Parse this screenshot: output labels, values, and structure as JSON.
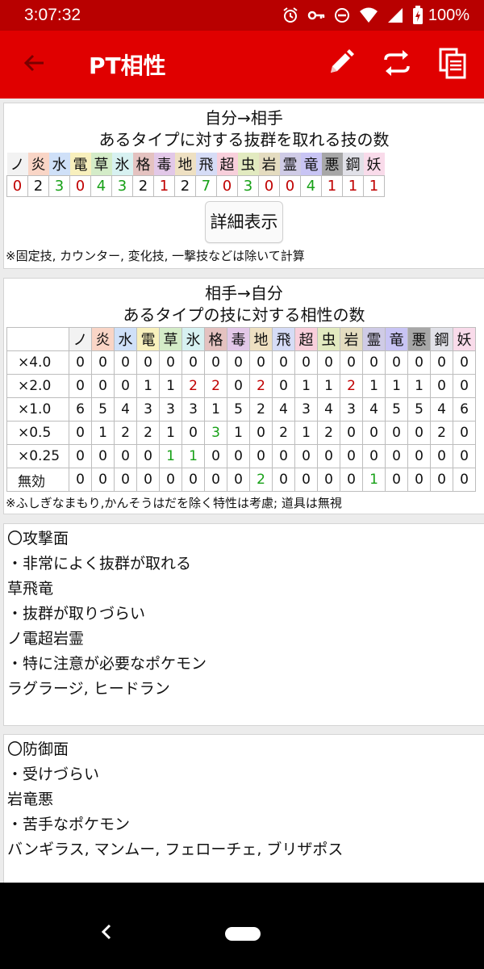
{
  "status": {
    "time": "3:07:32",
    "battery": "100%"
  },
  "appbar": {
    "title": "PT相性"
  },
  "types": [
    {
      "name": "ノ",
      "color": "#f2f2f2"
    },
    {
      "name": "炎",
      "color": "#f9d5c6"
    },
    {
      "name": "水",
      "color": "#cfe0f8"
    },
    {
      "name": "電",
      "color": "#f8f0bd"
    },
    {
      "name": "草",
      "color": "#d4ecc8"
    },
    {
      "name": "氷",
      "color": "#d7f1f1"
    },
    {
      "name": "格",
      "color": "#e4c2c0"
    },
    {
      "name": "毒",
      "color": "#e2c8e8"
    },
    {
      "name": "地",
      "color": "#eee0c2"
    },
    {
      "name": "飛",
      "color": "#d6dcf6"
    },
    {
      "name": "超",
      "color": "#f8cfdb"
    },
    {
      "name": "虫",
      "color": "#e2eac0"
    },
    {
      "name": "岩",
      "color": "#e4dcc0"
    },
    {
      "name": "霊",
      "color": "#cfcbe6"
    },
    {
      "name": "竜",
      "color": "#c8c4f4"
    },
    {
      "name": "悪",
      "color": "#a7a7a7"
    },
    {
      "name": "鋼",
      "color": "#e1e1e8"
    },
    {
      "name": "妖",
      "color": "#f9dbea"
    }
  ],
  "offense": {
    "title1": "自分→相手",
    "title2": "あるタイプに対する抜群を取れる技の数",
    "counts": [
      0,
      2,
      3,
      0,
      4,
      3,
      2,
      1,
      2,
      7,
      0,
      3,
      0,
      0,
      4,
      1,
      1,
      1
    ],
    "count_colors": [
      "red",
      "",
      "green",
      "red",
      "green",
      "green",
      "",
      "red",
      "",
      "green",
      "red",
      "green",
      "red",
      "red",
      "green",
      "red",
      "red",
      "red"
    ],
    "detail_button": "詳細表示",
    "note": "※固定技, カウンター, 変化技, 一撃技などは除いて計算"
  },
  "defense": {
    "title1": "相手→自分",
    "title2": "あるタイプの技に対する相性の数",
    "rows": [
      {
        "label": "×4.0",
        "values": [
          0,
          0,
          0,
          0,
          0,
          0,
          0,
          0,
          0,
          0,
          0,
          0,
          0,
          0,
          0,
          0,
          0,
          0
        ],
        "colors": [
          "",
          "",
          "",
          "",
          "",
          "",
          "",
          "",
          "",
          "",
          "",
          "",
          "",
          "",
          "",
          "",
          "",
          ""
        ]
      },
      {
        "label": "×2.0",
        "values": [
          0,
          0,
          0,
          1,
          1,
          2,
          2,
          0,
          2,
          0,
          1,
          1,
          2,
          1,
          1,
          1,
          0,
          0
        ],
        "colors": [
          "",
          "",
          "",
          "",
          "",
          "red",
          "red",
          "",
          "red",
          "",
          "",
          "",
          "red",
          "",
          "",
          "",
          "",
          ""
        ]
      },
      {
        "label": "×1.0",
        "values": [
          6,
          5,
          4,
          3,
          3,
          3,
          1,
          5,
          2,
          4,
          3,
          4,
          3,
          4,
          5,
          5,
          4,
          6
        ],
        "colors": [
          "",
          "",
          "",
          "",
          "",
          "",
          "",
          "",
          "",
          "",
          "",
          "",
          "",
          "",
          "",
          "",
          "",
          ""
        ]
      },
      {
        "label": "×0.5",
        "values": [
          0,
          1,
          2,
          2,
          1,
          0,
          3,
          1,
          0,
          2,
          1,
          2,
          0,
          0,
          0,
          0,
          2,
          0
        ],
        "colors": [
          "",
          "",
          "",
          "",
          "",
          "",
          "green",
          "",
          "",
          "",
          "",
          "",
          "",
          "",
          "",
          "",
          "",
          ""
        ]
      },
      {
        "label": "×0.25",
        "values": [
          0,
          0,
          0,
          0,
          1,
          1,
          0,
          0,
          0,
          0,
          0,
          0,
          0,
          0,
          0,
          0,
          0,
          0
        ],
        "colors": [
          "",
          "",
          "",
          "",
          "green",
          "green",
          "",
          "",
          "",
          "",
          "",
          "",
          "",
          "",
          "",
          "",
          "",
          ""
        ]
      },
      {
        "label": "無効",
        "values": [
          0,
          0,
          0,
          0,
          0,
          0,
          0,
          0,
          2,
          0,
          0,
          0,
          0,
          1,
          0,
          0,
          0,
          0
        ],
        "colors": [
          "",
          "",
          "",
          "",
          "",
          "",
          "",
          "",
          "green",
          "",
          "",
          "",
          "",
          "green",
          "",
          "",
          "",
          ""
        ]
      }
    ],
    "note": "※ふしぎなまもり,かんそうはだを除く特性は考慮; 道具は無視"
  },
  "attack_summary": {
    "heading": "〇攻撃面",
    "good_label": "・非常によく抜群が取れる",
    "good_types": "草飛竜",
    "bad_label": "・抜群が取りづらい",
    "bad_types": "ノ電超岩霊",
    "caution_label": "・特に注意が必要なポケモン",
    "caution_pokemon": "ラグラージ, ヒードラン"
  },
  "defense_summary": {
    "heading": "〇防御面",
    "hard_label": "・受けづらい",
    "hard_types": "岩竜悪",
    "weak_label": "・苦手なポケモン",
    "weak_pokemon": "バンギラス, マンムー, フェローチェ, ブリザポス"
  },
  "colors": {
    "appbar": "#e00000",
    "statusbar": "#b80000",
    "red_value": "#c00000",
    "green_value": "#16a016"
  },
  "icons": [
    "arrow-back-icon",
    "pencil-icon",
    "sync-icon",
    "copy-icon"
  ]
}
